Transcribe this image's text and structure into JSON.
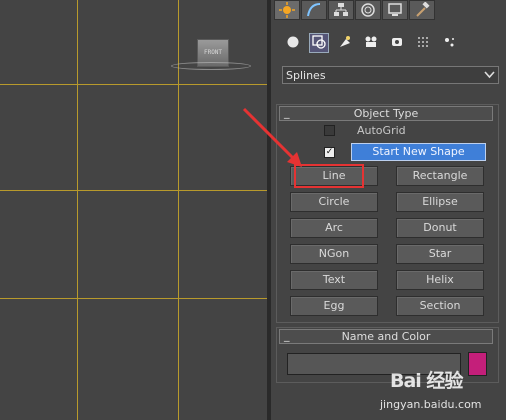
{
  "viewport": {
    "cube_label": "FRONT"
  },
  "command_panel": {
    "tabs": [
      {
        "icon": "sun-light-icon"
      },
      {
        "icon": "modify-curve-icon"
      },
      {
        "icon": "hierarchy-icon"
      },
      {
        "icon": "motion-icon"
      },
      {
        "icon": "display-monitor-icon"
      },
      {
        "icon": "utilities-hammer-icon"
      }
    ],
    "subtypes": [
      {
        "icon": "geometry-sphere-icon"
      },
      {
        "icon": "shapes-icon"
      },
      {
        "icon": "lights-icon"
      },
      {
        "icon": "cameras-icon"
      },
      {
        "icon": "helpers-icon"
      },
      {
        "icon": "spacewarps-icon"
      },
      {
        "icon": "systems-icon"
      }
    ],
    "category": "Splines",
    "object_type": {
      "title": "Object Type",
      "autogrid_label": "AutoGrid",
      "start_new_shape_label": "Start New Shape",
      "buttons": [
        "Line",
        "Rectangle",
        "Circle",
        "Ellipse",
        "Arc",
        "Donut",
        "NGon",
        "Star",
        "Text",
        "Helix",
        "Egg",
        "Section"
      ]
    },
    "name_and_color": {
      "title": "Name and Color",
      "name_value": "",
      "color": "#c41f7a"
    }
  },
  "watermark": {
    "logo": "Bai 经验",
    "url": "jingyan.baidu.com"
  },
  "colors": {
    "accent_blue": "#3f7fd8",
    "grid_line": "#b89a2c",
    "highlight_red": "#e53333"
  }
}
